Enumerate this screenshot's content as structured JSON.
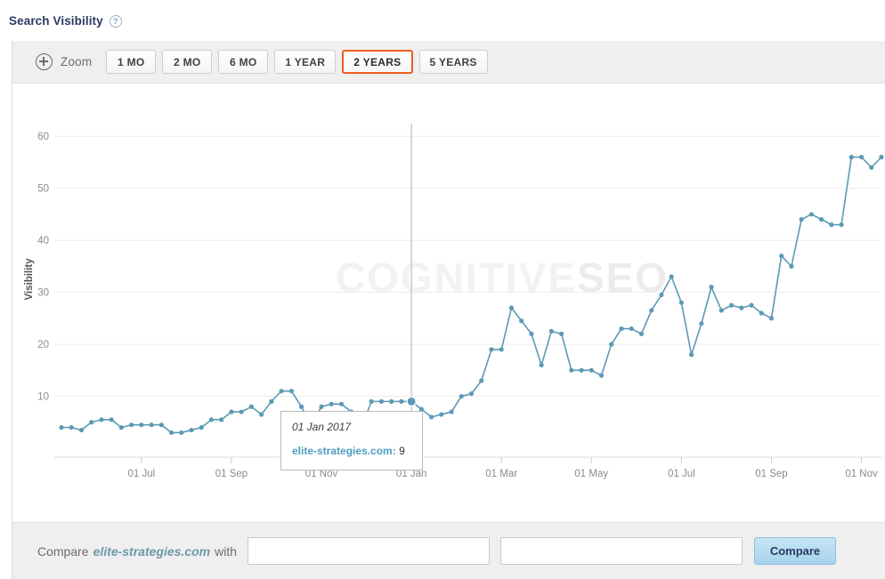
{
  "header": {
    "title": "Search Visibility",
    "help_icon": "question-mark-circle-icon"
  },
  "toolbar": {
    "zoom_icon": "zoom-in-circle-icon",
    "zoom_label": "Zoom",
    "ranges": [
      {
        "label": "1 MO",
        "active": false
      },
      {
        "label": "2 MO",
        "active": false
      },
      {
        "label": "6 MO",
        "active": false
      },
      {
        "label": "1 YEAR",
        "active": false
      },
      {
        "label": "2 YEARS",
        "active": true
      },
      {
        "label": "5 YEARS",
        "active": false
      }
    ],
    "active_range": "2 YEARS",
    "active_color": "#ef5c20"
  },
  "watermark": {
    "part1": "COGNITIVE",
    "part2": "SEO"
  },
  "tooltip": {
    "date": "01 Jan 2017",
    "series_label": "elite-strategies.com:",
    "value": "9"
  },
  "footer": {
    "compare_prefix": "Compare",
    "domain": "elite-strategies.com",
    "compare_suffix": "with",
    "input1_value": "",
    "input1_placeholder": "",
    "input2_value": "",
    "input2_placeholder": "",
    "button_label": "Compare"
  },
  "chart_data": {
    "type": "line",
    "title": "Search Visibility",
    "xlabel": "",
    "ylabel": "Visibility",
    "ylim": [
      0,
      65
    ],
    "yticks": [
      10,
      20,
      30,
      40,
      50,
      60
    ],
    "grid": true,
    "legend": "none",
    "line_color": "#5b9ab5",
    "marker_color": "#5b9ab5",
    "highlight_index": 35,
    "highlight_label": "01 Jan 2017",
    "highlight_value": 9,
    "xticks": [
      {
        "label": "01 Jul",
        "index": 8
      },
      {
        "label": "01 Sep",
        "index": 17
      },
      {
        "label": "01 Nov",
        "index": 26
      },
      {
        "label": "01 Jan",
        "index": 35
      },
      {
        "label": "01 Mar",
        "index": 44
      },
      {
        "label": "01 May",
        "index": 53
      },
      {
        "label": "01 Jul",
        "index": 62
      },
      {
        "label": "01 Sep",
        "index": 71
      },
      {
        "label": "01 Nov",
        "index": 80
      }
    ],
    "series": [
      {
        "name": "elite-strategies.com",
        "values": [
          4,
          4,
          3.5,
          5,
          5.5,
          5.5,
          4,
          4.5,
          4.5,
          4.5,
          4.5,
          3,
          3,
          3.5,
          4,
          5.5,
          5.5,
          7,
          7,
          8,
          6.5,
          9,
          11,
          11,
          8,
          4.5,
          8,
          8.5,
          8.5,
          7,
          4,
          9,
          9,
          9,
          9,
          9,
          7.5,
          6,
          6.5,
          7,
          10,
          10.5,
          13,
          19,
          19,
          27,
          24.5,
          22,
          16,
          22.5,
          22,
          15,
          15,
          15,
          14,
          20,
          23,
          23,
          22,
          26.5,
          29.5,
          33,
          28,
          18,
          24,
          31,
          26.5,
          27.5,
          27,
          27.5,
          26,
          25,
          37,
          35,
          44,
          45,
          44,
          43,
          43,
          56,
          56,
          54,
          56
        ]
      }
    ]
  }
}
